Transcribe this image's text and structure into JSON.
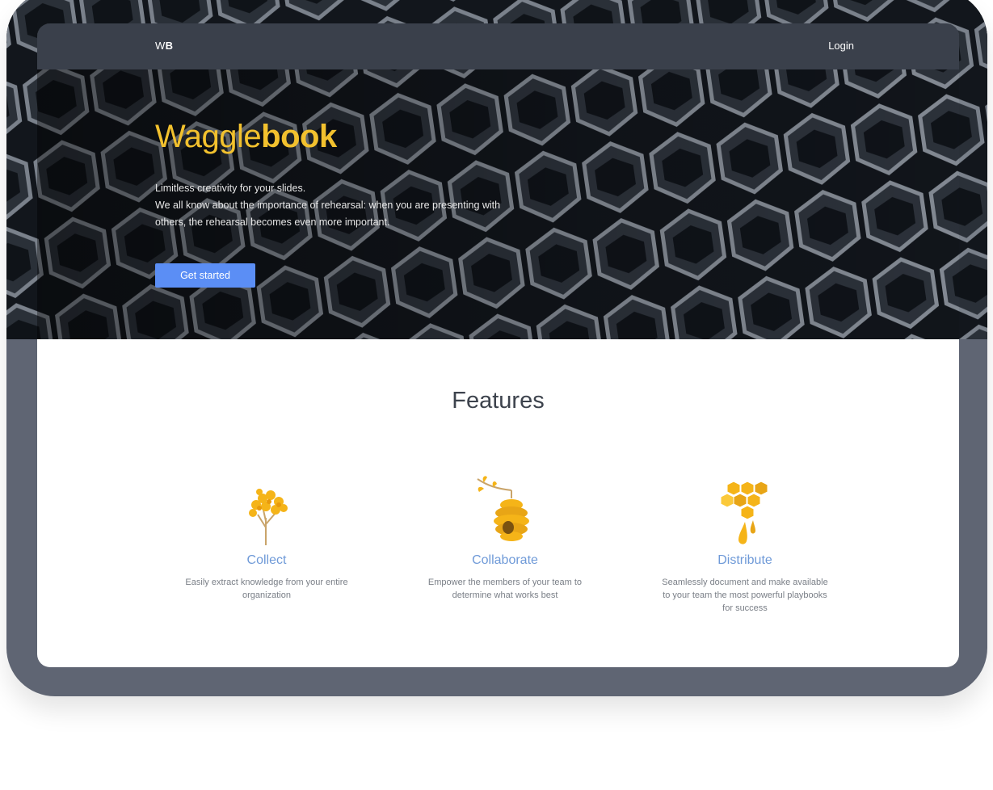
{
  "nav": {
    "logo_light": "W",
    "logo_bold": "B",
    "login": "Login"
  },
  "hero": {
    "brand_light": "Waggle",
    "brand_bold": "book",
    "tagline_lines": [
      "Limitless creativity for your slides.",
      "We all know about the importance of rehearsal: when you are presenting with",
      "others, the rehearsal becomes even more important."
    ],
    "cta": "Get started"
  },
  "features": {
    "title": "Features",
    "items": [
      {
        "title": "Collect",
        "lines": [
          "Easily extract knowledge from your entire",
          "organization"
        ],
        "icon": "tree-icon"
      },
      {
        "title": "Collaborate",
        "lines": [
          "Empower the members of your team to",
          "determine what works best"
        ],
        "icon": "beehive-icon"
      },
      {
        "title": "Distribute",
        "lines": [
          "Seamlessly document and make available",
          "to your team the most powerful playbooks",
          "for success"
        ],
        "icon": "honeycomb-icon"
      }
    ]
  },
  "colors": {
    "accent": "#f2c12e",
    "button": "#5b8ef5",
    "feature_title": "#6f9ad8",
    "frame": "#5f6573",
    "navbar": "#3a404b"
  }
}
